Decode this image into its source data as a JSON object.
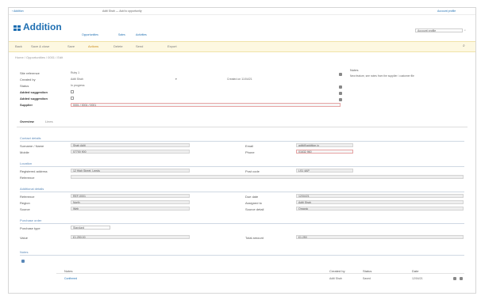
{
  "topbar": {
    "left_link": "‹ Addition",
    "center_text": "Aditi Shah — Add to opportunity",
    "right_link": "Aditi Shah — Add to opportunity"
  },
  "app": {
    "logo_text": "Addition",
    "nav_links": [
      "Opportunities",
      "Sales",
      "Activities"
    ],
    "user_label": "Account profile"
  },
  "actions": [
    "Back",
    "Save & close",
    "Save",
    "Actions",
    "Delete",
    "Send",
    "Export"
  ],
  "crumb": "Home / Opportunities / 0001 / Edit",
  "header": {
    "fields": [
      {
        "label": "Site reference",
        "value": "Ruby 1"
      },
      {
        "label": "Created by",
        "value": "Aditi Shah"
      },
      {
        "label": "Status",
        "value": "In progress"
      },
      {
        "label": "Added suggestion",
        "value": ""
      },
      {
        "label": "Added suggestion",
        "value": ""
      },
      {
        "label": "Supplier",
        "value": "0001 / 0001 / 0001"
      }
    ],
    "created_on": "Created on 11/04/21",
    "right_panel_label": "Notes",
    "right_panel_value": "New feature, see notes from the supplier / customer file"
  },
  "tabs": [
    "Overview",
    "Lines"
  ],
  "sections": [
    {
      "title": "Contact details"
    },
    {
      "title": "Location"
    },
    {
      "title": "Additional details"
    },
    {
      "title": "Purchase order"
    },
    {
      "title": "Notes"
    }
  ],
  "contact": {
    "rows": [
      {
        "l1": "Surname / Name",
        "v1": "Shah Aditi",
        "l2": "Email",
        "v2": "aditi@addition.io"
      },
      {
        "l1": "Mobile",
        "v1": "07700 900",
        "l2": "Phone",
        "v2": "01632 960"
      }
    ]
  },
  "location": {
    "rows": [
      {
        "l1": "Registered address",
        "v1": "12 High Street, Leeds",
        "l2": "Post code",
        "v2": "LS1 4AP"
      },
      {
        "l1": "Reference",
        "v1": "",
        "l2": "",
        "v2": ""
      }
    ]
  },
  "additional": {
    "rows": [
      {
        "l1": "Reference",
        "v1": "REF-0001",
        "l2": "Due date",
        "v2": "12/04/21"
      },
      {
        "l1": "Region",
        "v1": "North",
        "l2": "Assigned to",
        "v2": "Aditi Shah"
      },
      {
        "l1": "Source",
        "v1": "Web",
        "l2": "Source detail",
        "v2": "Organic"
      }
    ]
  },
  "purchase": {
    "rows": [
      {
        "l1": "Purchase type",
        "v1": "Standard",
        "l2": "",
        "v2": ""
      },
      {
        "l1": "Value",
        "v1": "£1,250.00",
        "l2": "Total amount",
        "v2": "£1,250"
      }
    ]
  },
  "notes_table": {
    "headers": [
      "Notes",
      "Created by",
      "Status",
      "Date"
    ],
    "row": {
      "note": "Confirmed",
      "by": "Aditi Shah",
      "status": "Saved",
      "date": "12/04/21"
    }
  },
  "colors": {
    "accent": "#1f6fb2",
    "action_bar": "#fdf8e1",
    "section": "#5a88b8"
  }
}
